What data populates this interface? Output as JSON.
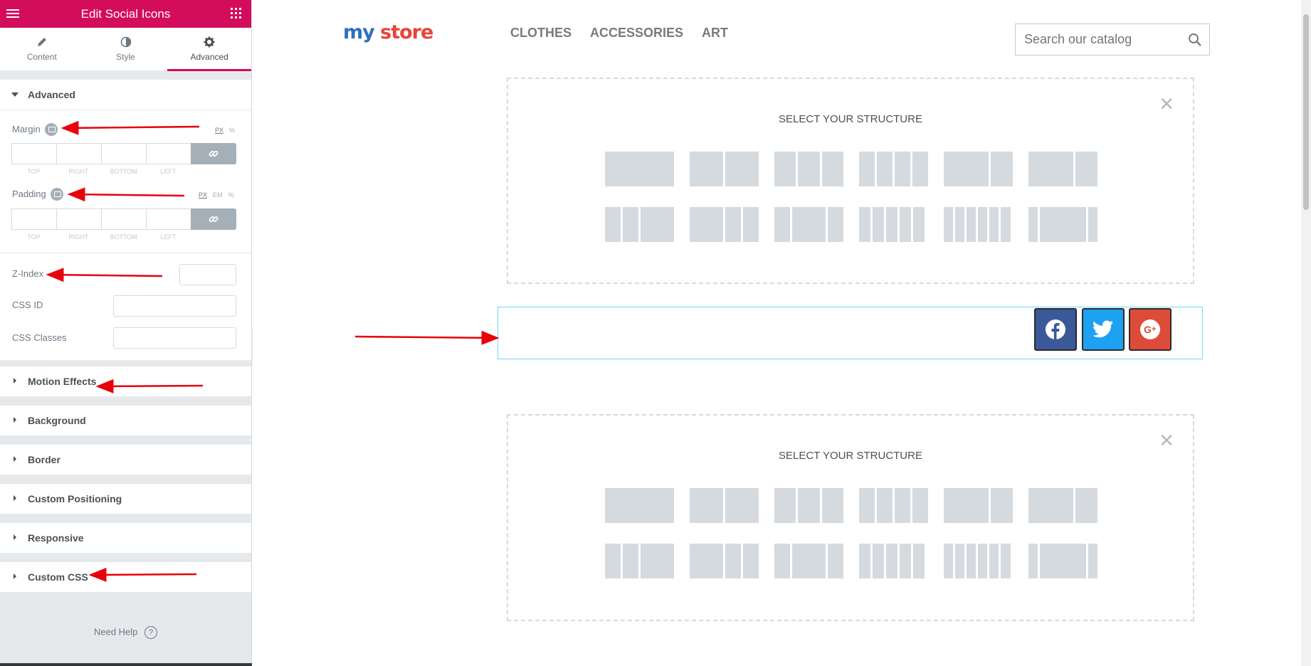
{
  "panel": {
    "title": "Edit Social Icons",
    "tabs": [
      {
        "label": "Content",
        "icon": "pencil-icon"
      },
      {
        "label": "Style",
        "icon": "contrast-icon"
      },
      {
        "label": "Advanced",
        "icon": "gear-icon",
        "active": true
      }
    ],
    "advanced": {
      "heading": "Advanced",
      "margin": {
        "label": "Margin",
        "units": [
          "PX",
          "%"
        ],
        "active_unit": "PX",
        "fields": [
          "TOP",
          "RIGHT",
          "BOTTOM",
          "LEFT"
        ]
      },
      "padding": {
        "label": "Padding",
        "units": [
          "PX",
          "EM",
          "%"
        ],
        "active_unit": "PX",
        "fields": [
          "TOP",
          "RIGHT",
          "BOTTOM",
          "LEFT"
        ]
      },
      "z_index": {
        "label": "Z-Index",
        "value": ""
      },
      "css_id": {
        "label": "CSS ID",
        "value": ""
      },
      "css_classes": {
        "label": "CSS Classes",
        "value": ""
      }
    },
    "sections": [
      "Motion Effects",
      "Background",
      "Border",
      "Custom Positioning",
      "Responsive",
      "Custom CSS"
    ],
    "need_help": "Need Help",
    "colors": {
      "accent": "#d30c5c"
    }
  },
  "preview": {
    "logo": {
      "part1": "my",
      "part2": "store"
    },
    "nav": [
      "CLOTHES",
      "ACCESSORIES",
      "ART"
    ],
    "search_placeholder": "Search our catalog",
    "structure_title": "SELECT YOUR STRUCTURE",
    "social_icons": [
      {
        "name": "facebook",
        "color": "#3b5998"
      },
      {
        "name": "twitter",
        "color": "#1da1f2"
      },
      {
        "name": "google-plus",
        "color": "#dd4b39"
      }
    ]
  }
}
